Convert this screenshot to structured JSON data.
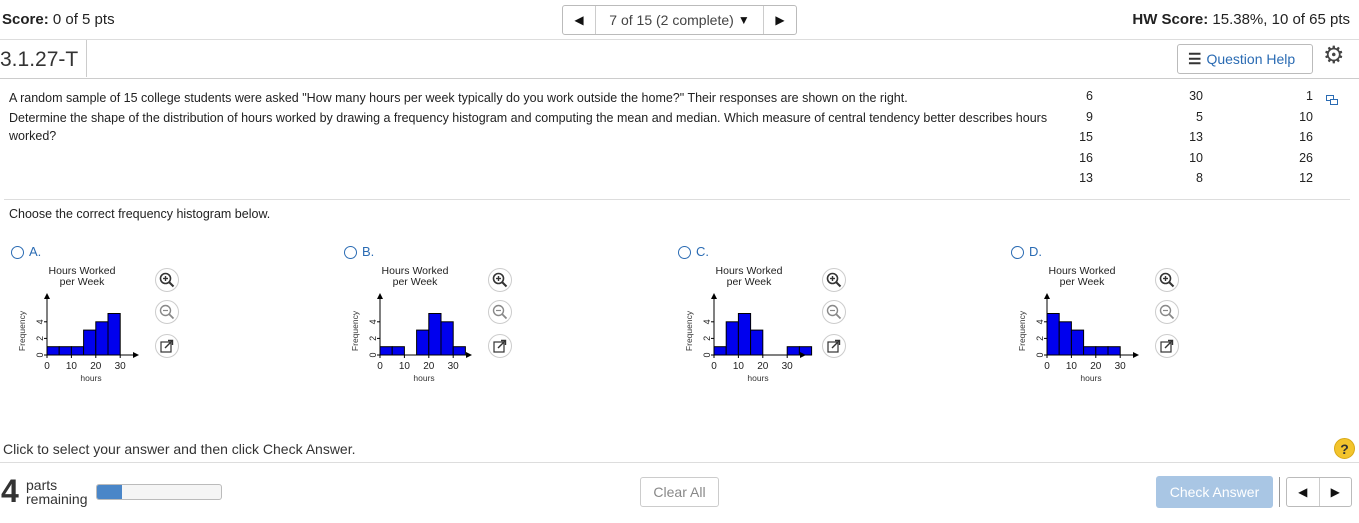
{
  "header": {
    "score_label": "Score:",
    "score_value": "0 of 5 pts",
    "nav_position": "7 of 15 (2 complete)",
    "hw_score_label": "HW Score:",
    "hw_score_value": "15.38%, 10 of 65 pts"
  },
  "question": {
    "id": "3.1.27-T",
    "help_label": "Question Help",
    "text_line1": "A random sample of 15 college students were asked \"How many hours per week typically do you work outside the home?\" Their responses are shown on the right.",
    "text_line2": "Determine the shape of the distribution of hours worked by drawing a frequency histogram and computing the mean and median. Which measure of central tendency better describes hours worked?",
    "data": [
      [
        "6",
        "30",
        "1"
      ],
      [
        "9",
        "5",
        "10"
      ],
      [
        "15",
        "13",
        "16"
      ],
      [
        "16",
        "10",
        "26"
      ],
      [
        "13",
        "8",
        "12"
      ]
    ],
    "choose_text": "Choose the correct frequency histogram below."
  },
  "options": [
    {
      "label": "A.",
      "title_line1": "Hours Worked",
      "title_line2": "per Week",
      "ylabel": "Frequency",
      "xlabel": "hours",
      "yticks": [
        "0",
        "2",
        "4"
      ],
      "xticks": [
        "0",
        "10",
        "20",
        "30"
      ],
      "frequencies": [
        1,
        1,
        1,
        3,
        4,
        5
      ]
    },
    {
      "label": "B.",
      "title_line1": "Hours Worked",
      "title_line2": "per Week",
      "ylabel": "Frequency",
      "xlabel": "hours",
      "yticks": [
        "0",
        "2",
        "4"
      ],
      "xticks": [
        "0",
        "10",
        "20",
        "30"
      ],
      "frequencies": [
        1,
        1,
        0,
        3,
        5,
        4,
        1
      ]
    },
    {
      "label": "C.",
      "title_line1": "Hours Worked",
      "title_line2": "per Week",
      "ylabel": "Frequency",
      "xlabel": "hours",
      "yticks": [
        "0",
        "2",
        "4"
      ],
      "xticks": [
        "0",
        "10",
        "20",
        "30"
      ],
      "frequencies": [
        1,
        4,
        5,
        3,
        0,
        0,
        1,
        1
      ]
    },
    {
      "label": "D.",
      "title_line1": "Hours Worked",
      "title_line2": "per Week",
      "ylabel": "Frequency",
      "xlabel": "hours",
      "yticks": [
        "0",
        "2",
        "4"
      ],
      "xticks": [
        "0",
        "10",
        "20",
        "30"
      ],
      "frequencies": [
        5,
        4,
        3,
        1,
        1,
        1
      ]
    }
  ],
  "histogram_style": {
    "bar_color": "#0000ee",
    "bin_width": 5
  },
  "footer": {
    "instruction": "Click to select your answer and then click Check Answer.",
    "parts_number": "4",
    "parts_line1": "parts",
    "parts_line2": "remaining",
    "progress_fraction": 0.2,
    "clear_all": "Clear All",
    "check_answer": "Check Answer"
  },
  "colors": {
    "accent": "#2a6bb3",
    "check_button": "#a9c6e4",
    "progress_fill": "#4a86c8",
    "help_icon": "#f3c42c"
  },
  "icons": [
    "caret-left-icon",
    "caret-right-icon",
    "dropdown-caret-icon",
    "list-icon",
    "gear-icon",
    "copy-icon",
    "zoom-in-icon",
    "zoom-out-icon",
    "popout-icon",
    "help-icon"
  ]
}
